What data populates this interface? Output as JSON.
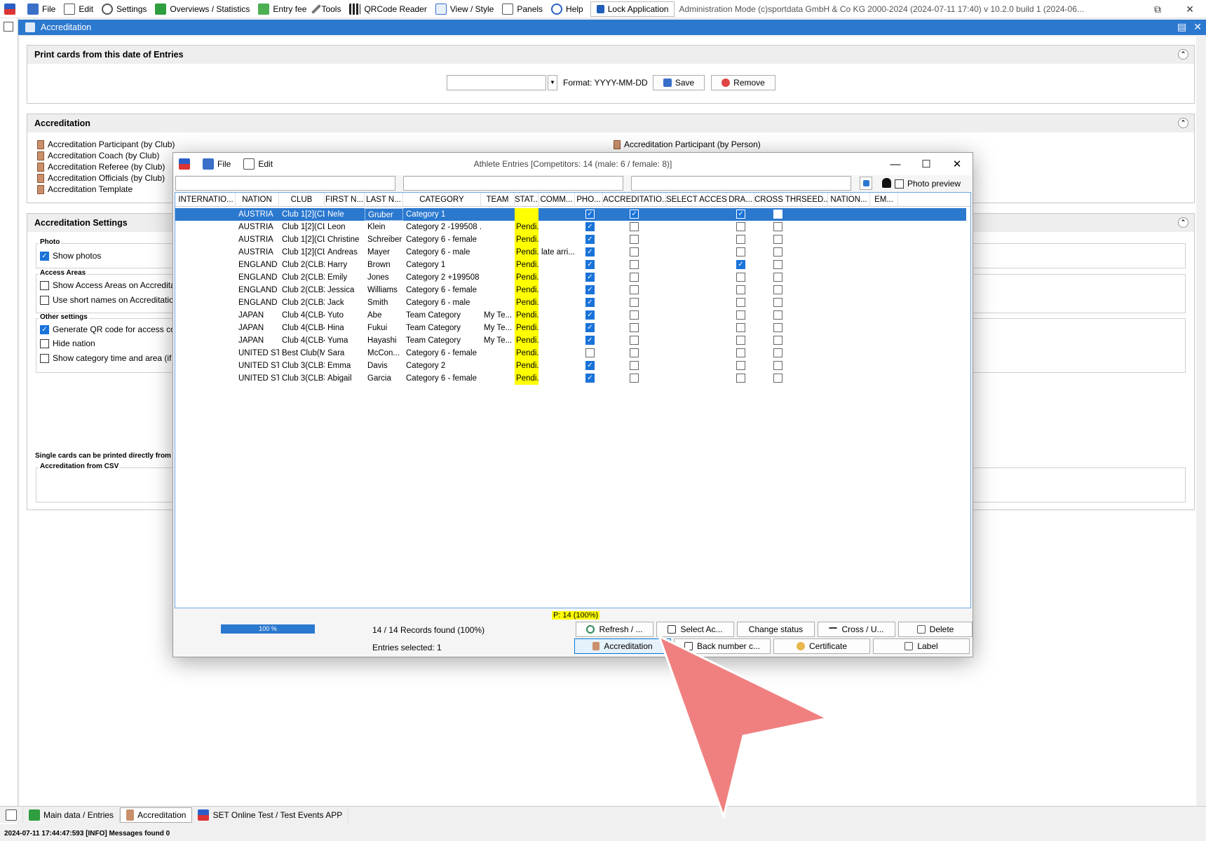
{
  "menubar": {
    "items": [
      "File",
      "Edit",
      "Settings",
      "Overviews / Statistics",
      "Entry fee",
      "Tools",
      "QRCode Reader",
      "View / Style",
      "Panels",
      "Help"
    ],
    "lock_label": "Lock Application",
    "admin_title": "Administration Mode (c)sportdata GmbH & Co KG 2000-2024 (2024-07-11 17:40)  v 10.2.0 build 1 (2024-06..."
  },
  "window": {
    "title": "Accreditation"
  },
  "print_section": {
    "title": "Print cards from this date of Entries",
    "date_value": "",
    "format_label": "Format: YYYY-MM-DD",
    "save_label": "Save",
    "remove_label": "Remove"
  },
  "accreditation_section": {
    "title": "Accreditation",
    "left_items": [
      "Accreditation Participant (by Club)",
      "Accreditation Coach (by Club)",
      "Accreditation Referee (by Club)",
      "Accreditation Officials (by Club)",
      "Accreditation Template"
    ],
    "right_items": [
      "Accreditation Participant (by Person)"
    ]
  },
  "settings_section": {
    "title": "Accreditation Settings",
    "photo_group": "Photo",
    "show_photos": "Show photos",
    "access_group": "Access Areas",
    "show_access": "Show Access Areas on Accreditat",
    "use_short": "Use short names on Accreditatio",
    "other_group": "Other settings",
    "generate_qr": "Generate QR code for access con",
    "hide_nation": "Hide nation",
    "show_category": "Show category time and area (if a",
    "single_cards": "Single cards can be printed directly from",
    "csv_group": "Accreditation from CSV"
  },
  "popup": {
    "menu_file": "File",
    "menu_edit": "Edit",
    "title": "Athlete Entries [Competitors: 14 (male: 6 / female: 8)]",
    "photo_preview": "Photo preview",
    "columns": [
      "INTERNATIO...",
      "NATION",
      "CLUB",
      "FIRST N...",
      "LAST N...",
      "CATEGORY",
      "TEAM",
      "STAT...",
      "COMM...",
      "PHO...",
      "ACCREDITATIO...",
      "SELECT ACCESS...",
      "DRA...",
      "CROSS THR...",
      "SEED...",
      "NATION...",
      "EM..."
    ],
    "rows": [
      {
        "nation": "AUSTRIA",
        "club": "Club 1[2](CL...",
        "first": "Nele",
        "last": "Gruber",
        "category": "Category 1",
        "team": "",
        "status": "Pendi...",
        "comment": "",
        "photo": true,
        "accred": true,
        "draw": true,
        "cross": false
      },
      {
        "nation": "AUSTRIA",
        "club": "Club 1[2](CL...",
        "first": "Leon",
        "last": "Klein",
        "category": "Category 2 -199508 ...",
        "team": "",
        "status": "Pendi...",
        "comment": "",
        "photo": true,
        "accred": false,
        "draw": false,
        "cross": false
      },
      {
        "nation": "AUSTRIA",
        "club": "Club 1[2](CL...",
        "first": "Christine",
        "last": "Schreiber",
        "category": "Category 6 - female",
        "team": "",
        "status": "Pendi...",
        "comment": "",
        "photo": true,
        "accred": false,
        "draw": false,
        "cross": false
      },
      {
        "nation": "AUSTRIA",
        "club": "Club 1[2](CL...",
        "first": "Andreas",
        "last": "Mayer",
        "category": "Category 6 - male",
        "team": "",
        "status": "Pendi...",
        "comment": "late arri...",
        "photo": true,
        "accred": false,
        "draw": false,
        "cross": false
      },
      {
        "nation": "ENGLAND",
        "club": "Club 2(CLB2)",
        "first": "Harry",
        "last": "Brown",
        "category": "Category 1",
        "team": "",
        "status": "Pendi...",
        "comment": "",
        "photo": true,
        "accred": false,
        "draw": true,
        "cross": false
      },
      {
        "nation": "ENGLAND",
        "club": "Club 2(CLB2)",
        "first": "Emily",
        "last": "Jones",
        "category": "Category 2 +199508 ...",
        "team": "",
        "status": "Pendi...",
        "comment": "",
        "photo": true,
        "accred": false,
        "draw": false,
        "cross": false
      },
      {
        "nation": "ENGLAND",
        "club": "Club 2(CLB2)",
        "first": "Jessica",
        "last": "Williams",
        "category": "Category 6 - female",
        "team": "",
        "status": "Pendi...",
        "comment": "",
        "photo": true,
        "accred": false,
        "draw": false,
        "cross": false
      },
      {
        "nation": "ENGLAND",
        "club": "Club 2(CLB2)",
        "first": "Jack",
        "last": "Smith",
        "category": "Category 6 - male",
        "team": "",
        "status": "Pendi...",
        "comment": "",
        "photo": true,
        "accred": false,
        "draw": false,
        "cross": false
      },
      {
        "nation": "JAPAN",
        "club": "Club 4(CLB4)",
        "first": "Yuto",
        "last": "Abe",
        "category": "Team Category",
        "team": "My Te...",
        "status": "Pendi...",
        "comment": "",
        "photo": true,
        "accred": false,
        "draw": false,
        "cross": false
      },
      {
        "nation": "JAPAN",
        "club": "Club 4(CLB4)",
        "first": "Hina",
        "last": "Fukui",
        "category": "Team Category",
        "team": "My Te...",
        "status": "Pendi...",
        "comment": "",
        "photo": true,
        "accred": false,
        "draw": false,
        "cross": false
      },
      {
        "nation": "JAPAN",
        "club": "Club 4(CLB4)",
        "first": "Yuma",
        "last": "Hayashi",
        "category": "Team Category",
        "team": "My Te...",
        "status": "Pendi...",
        "comment": "",
        "photo": true,
        "accred": false,
        "draw": false,
        "cross": false
      },
      {
        "nation": "UNITED ST...",
        "club": "Best Club(M...",
        "first": "Sara",
        "last": "McCon...",
        "category": "Category 6 - female",
        "team": "",
        "status": "Pendi...",
        "comment": "",
        "photo": false,
        "accred": false,
        "draw": false,
        "cross": false
      },
      {
        "nation": "UNITED ST...",
        "club": "Club 3(CLB3)",
        "first": "Emma",
        "last": "Davis",
        "category": "Category 2",
        "team": "",
        "status": "Pendi...",
        "comment": "",
        "photo": true,
        "accred": false,
        "draw": false,
        "cross": false
      },
      {
        "nation": "UNITED ST...",
        "club": "Club 3(CLB3)",
        "first": "Abigail",
        "last": "Garcia",
        "category": "Category 6 - female",
        "team": "",
        "status": "Pendi...",
        "comment": "",
        "photo": true,
        "accred": false,
        "draw": false,
        "cross": false
      }
    ],
    "status_count": "P: 14 (100%)",
    "progress_label": "100 %",
    "progress_value": 1.0,
    "records_found": "14 / 14 Records found (100%)",
    "entries_selected": "Entries selected: 1",
    "btn_refresh": "Refresh / ...",
    "btn_select": "Select Ac...",
    "btn_change": "Change status",
    "btn_cross": "Cross / U...",
    "btn_delete": "Delete",
    "btn_accreditation": "Accreditation",
    "btn_backnumber": "Back number c...",
    "btn_certificate": "Certificate",
    "btn_label": "Label"
  },
  "bottom_tabs": [
    "Main data / Entries",
    "Accreditation",
    "SET Online Test / Test Events APP"
  ],
  "status_bar": "2024-07-11 17:44:47:593 [INFO] Messages found 0",
  "colors": {
    "accent": "#2b78cf",
    "status_highlight": "#ffff00",
    "cursor": "#f08080"
  }
}
